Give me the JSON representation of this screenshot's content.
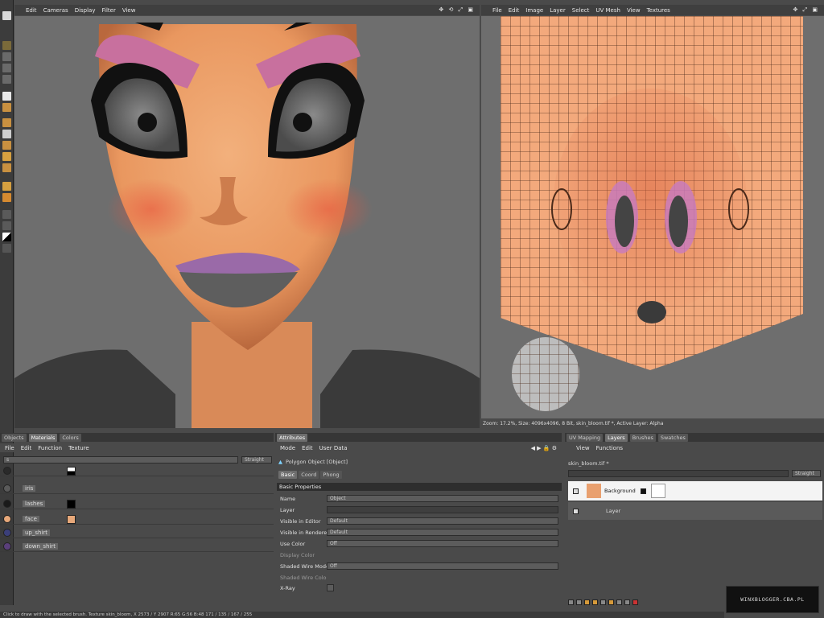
{
  "left_viewport": {
    "menu": [
      "Edit",
      "Cameras",
      "Display",
      "Filter",
      "View"
    ]
  },
  "right_viewport": {
    "menu": [
      "File",
      "Edit",
      "Image",
      "Layer",
      "Select",
      "UV Mesh",
      "View",
      "Textures"
    ],
    "status": "Zoom: 17.2%, Size: 4096x4096, 8 Bit, skin_bloom.tif *, Active Layer: Alpha"
  },
  "materials_panel": {
    "tabs": [
      "Objects",
      "Materials",
      "Colors"
    ],
    "active_tab": "Materials",
    "menu": [
      "File",
      "Edit",
      "Function",
      "Texture"
    ],
    "search_value": "s",
    "mode_dropdown": "Straight",
    "materials": [
      {
        "name": "",
        "swatch": "#2a2a2a"
      },
      {
        "name": "iris",
        "swatch": "#5a5a5a"
      },
      {
        "name": "lashes",
        "swatch": "#1a1a1a"
      },
      {
        "name": "face",
        "swatch": "#e7a87a"
      },
      {
        "name": "up_shirt",
        "swatch": "#3b3f7a"
      },
      {
        "name": "down_shirt",
        "swatch": "#5a3f7a"
      }
    ]
  },
  "attributes_panel": {
    "tab": "Attributes",
    "menu": [
      "Mode",
      "Edit",
      "User Data"
    ],
    "object_title": "Polygon Object [Object]",
    "subtabs": [
      "Basic",
      "Coord",
      "Phong"
    ],
    "active_subtab": "Basic",
    "section": "Basic Properties",
    "props": [
      {
        "label": "Name",
        "value": "Object",
        "dim": false
      },
      {
        "label": "Layer",
        "value": "",
        "dim": false
      },
      {
        "label": "Visible in Editor",
        "value": "Default",
        "dim": false
      },
      {
        "label": "Visible in Renderer",
        "value": "Default",
        "dim": false
      },
      {
        "label": "Use Color",
        "value": "Off",
        "dim": false
      },
      {
        "label": "Display Color",
        "value": "",
        "dim": true
      },
      {
        "label": "Shaded Wire Mode",
        "value": "Off",
        "dim": false
      },
      {
        "label": "Shaded Wire Color",
        "value": "",
        "dim": true
      },
      {
        "label": "X-Ray",
        "value": "",
        "dim": false
      }
    ]
  },
  "layers_panel": {
    "tabs": [
      "UV Mapping",
      "Layers",
      "Brushes",
      "Swatches"
    ],
    "active_tab": "Layers",
    "menu": [
      "View",
      "Functions"
    ],
    "file_name": "skin_bloom.tif *",
    "mode_dropdown": "Straight",
    "layers": [
      {
        "name": "Background"
      },
      {
        "name": "Layer"
      }
    ]
  },
  "status_bar": {
    "text": "Click to draw with the selected brush. Texture skin_bloom, X 2573 / Y 2907 R:65 G:56 B:48 171 / 135 / 167 / 255"
  },
  "watermark": {
    "text": "WINXBLOGGER.CBA.PL"
  },
  "colors": {
    "skin": "#e9a06f",
    "uv_mesh_bg": "#f3a97c",
    "selected_row": "#f4f4f4",
    "panel_bg": "#4a4a4a"
  }
}
